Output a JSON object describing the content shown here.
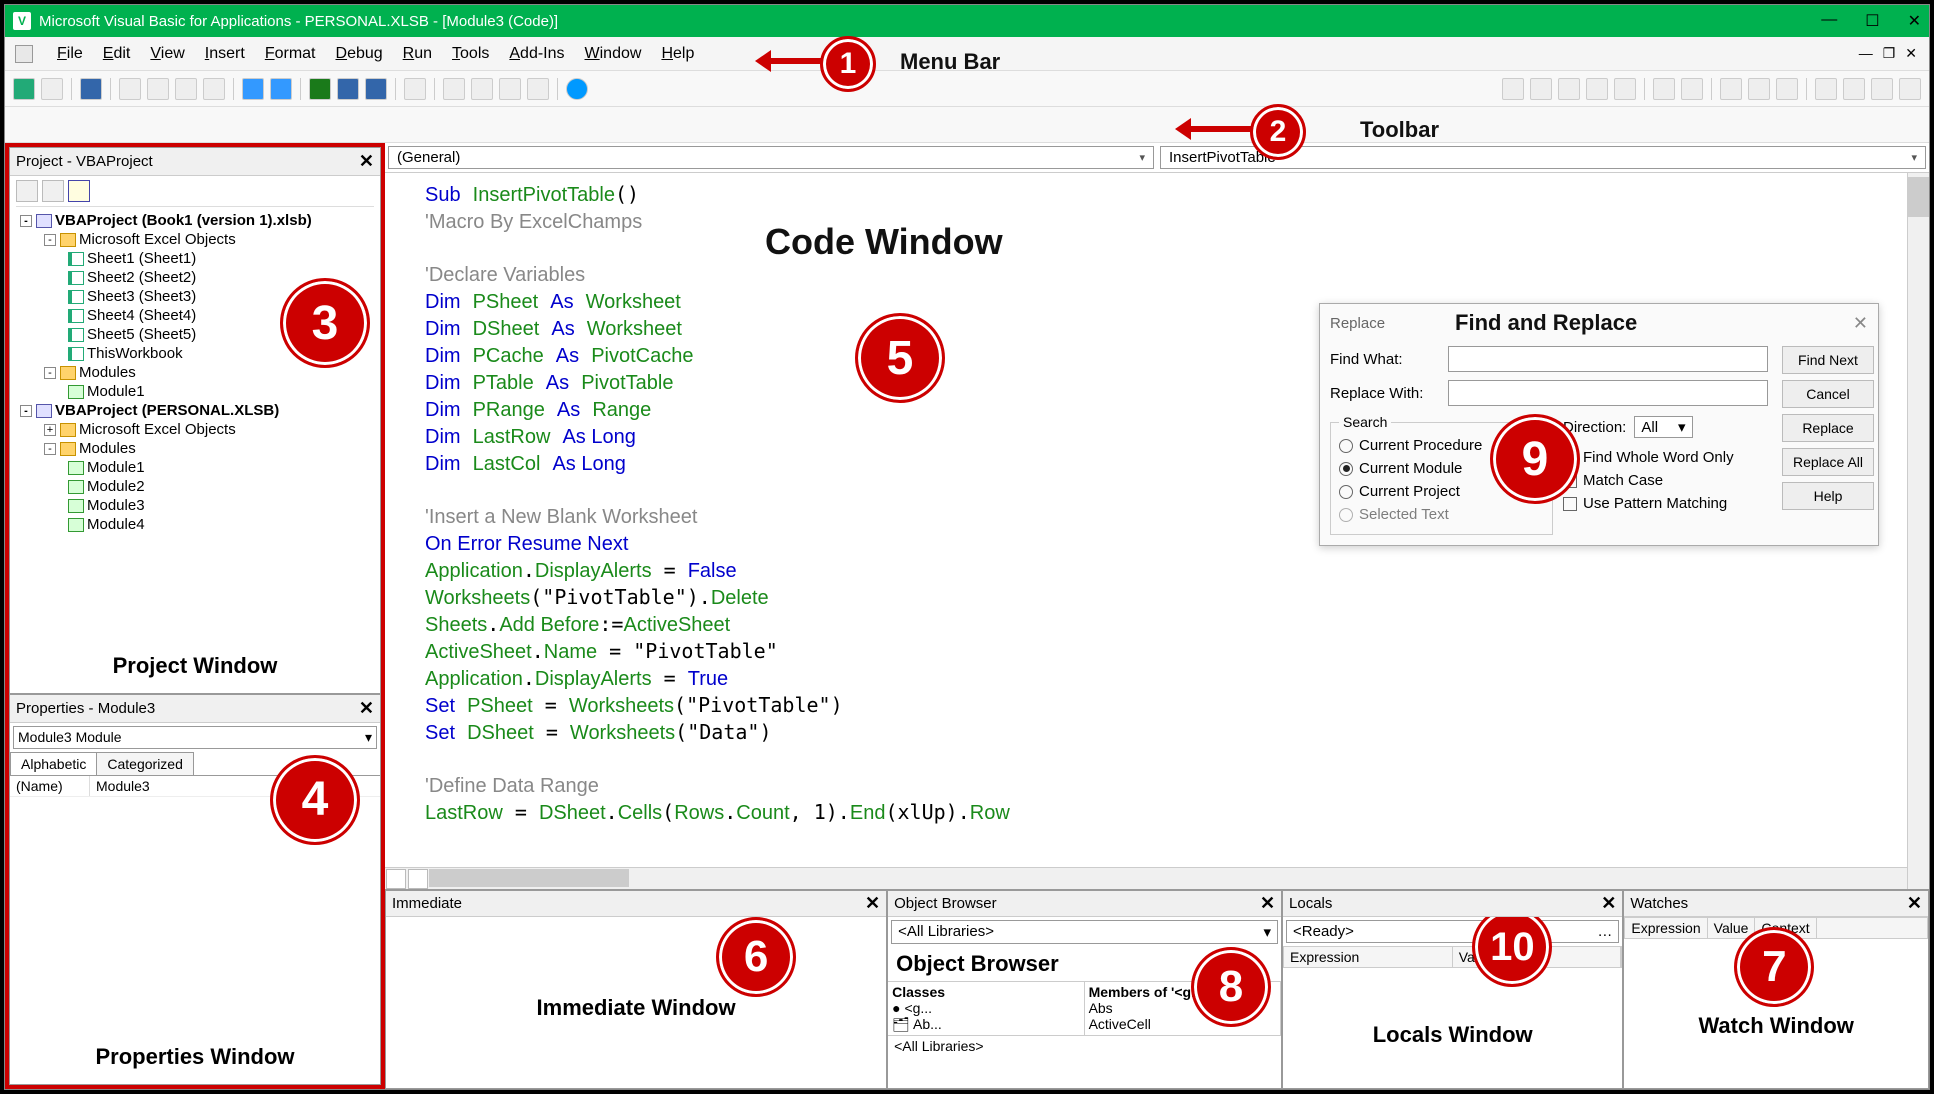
{
  "titlebar": {
    "title": "Microsoft Visual Basic for Applications - PERSONAL.XLSB - [Module3 (Code)]"
  },
  "menubar": {
    "items": [
      "File",
      "Edit",
      "View",
      "Insert",
      "Format",
      "Debug",
      "Run",
      "Tools",
      "Add-Ins",
      "Window",
      "Help"
    ],
    "label": "Menu Bar"
  },
  "toolbar": {
    "label": "Toolbar"
  },
  "project": {
    "title": "Project - VBAProject",
    "label": "Project Window",
    "nodes": [
      {
        "l": 0,
        "exp": "-",
        "icon": "proj",
        "text": "VBAProject (Book1 (version 1).xlsb)",
        "bold": true
      },
      {
        "l": 1,
        "exp": "-",
        "icon": "folder",
        "text": "Microsoft Excel Objects"
      },
      {
        "l": 2,
        "icon": "excel",
        "text": "Sheet1 (Sheet1)"
      },
      {
        "l": 2,
        "icon": "excel",
        "text": "Sheet2 (Sheet2)"
      },
      {
        "l": 2,
        "icon": "excel",
        "text": "Sheet3 (Sheet3)"
      },
      {
        "l": 2,
        "icon": "excel",
        "text": "Sheet4 (Sheet4)"
      },
      {
        "l": 2,
        "icon": "excel",
        "text": "Sheet5 (Sheet5)"
      },
      {
        "l": 2,
        "icon": "excel",
        "text": "ThisWorkbook"
      },
      {
        "l": 1,
        "exp": "-",
        "icon": "folder",
        "text": "Modules"
      },
      {
        "l": 2,
        "icon": "module",
        "text": "Module1"
      },
      {
        "l": 0,
        "exp": "-",
        "icon": "proj",
        "text": "VBAProject (PERSONAL.XLSB)",
        "bold": true
      },
      {
        "l": 1,
        "exp": "+",
        "icon": "folder",
        "text": "Microsoft Excel Objects"
      },
      {
        "l": 1,
        "exp": "-",
        "icon": "folder",
        "text": "Modules"
      },
      {
        "l": 2,
        "icon": "module",
        "text": "Module1"
      },
      {
        "l": 2,
        "icon": "module",
        "text": "Module2"
      },
      {
        "l": 2,
        "icon": "module",
        "text": "Module3"
      },
      {
        "l": 2,
        "icon": "module",
        "text": "Module4"
      }
    ]
  },
  "properties": {
    "title": "Properties - Module3",
    "combo": "Module3 Module",
    "tabs": [
      "Alphabetic",
      "Categorized"
    ],
    "row_name": "(Name)",
    "row_val": "Module3",
    "label": "Properties Window"
  },
  "codedrop": {
    "left": "(General)",
    "right": "InsertPivotTable"
  },
  "code_title": "Code Window",
  "replace": {
    "title": "Replace",
    "big": "Find and Replace",
    "find_label": "Find What:",
    "replace_label": "Replace With:",
    "search_legend": "Search",
    "r1": "Current Procedure",
    "r2": "Current Module",
    "r3": "Current Project",
    "r4": "Selected Text",
    "dir_label": "Direction:",
    "dir_val": "All",
    "c1": "Find Whole Word Only",
    "c2": "Match Case",
    "c3": "Use Pattern Matching",
    "b_findnext": "Find Next",
    "b_cancel": "Cancel",
    "b_replace": "Replace",
    "b_replaceall": "Replace All",
    "b_help": "Help"
  },
  "immediate": {
    "title": "Immediate",
    "label": "Immediate Window"
  },
  "objbrowser": {
    "title": "Object Browser",
    "lib": "<All Libraries>",
    "big": "Object Browser",
    "classes_hdr": "Classes",
    "members_hdr": "Members of '<globals>'",
    "m1": "Abs",
    "m2": "ActiveCell",
    "status": "<All Libraries>"
  },
  "locals": {
    "title": "Locals",
    "ready": "<Ready>",
    "h1": "Expression",
    "h2": "Value",
    "label": "Locals Window"
  },
  "watches": {
    "title": "Watches",
    "h1": "Expression",
    "h2": "Value",
    "h3": "Context",
    "label": "Watch Window"
  },
  "annotations": {
    "n1": "1",
    "n2": "2",
    "n3": "3",
    "n4": "4",
    "n5": "5",
    "n6": "6",
    "n7": "7",
    "n8": "8",
    "n9": "9",
    "n10": "10"
  }
}
